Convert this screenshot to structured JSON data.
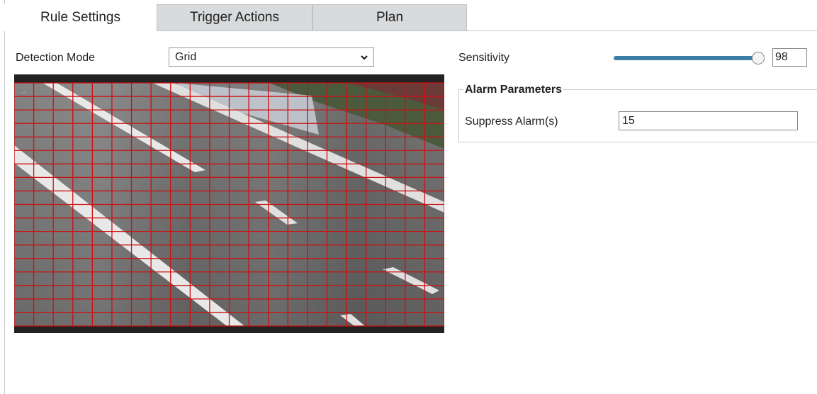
{
  "tabs": [
    {
      "label": "Rule Settings",
      "active": true
    },
    {
      "label": "Trigger Actions",
      "active": false
    },
    {
      "label": "Plan",
      "active": false
    }
  ],
  "detection_mode": {
    "label": "Detection Mode",
    "selected": "Grid"
  },
  "sensitivity": {
    "label": "Sensitivity",
    "value": "98"
  },
  "alarm_parameters": {
    "legend": "Alarm Parameters",
    "suppress_label": "Suppress Alarm(s)",
    "suppress_value": "15"
  },
  "video": {
    "overlay_text": "...",
    "grid_color": "#cc1111",
    "grid_columns": 22,
    "grid_rows": 18
  },
  "colors": {
    "slider": "#3d7ea6",
    "tab_inactive": "#d8dadc"
  }
}
